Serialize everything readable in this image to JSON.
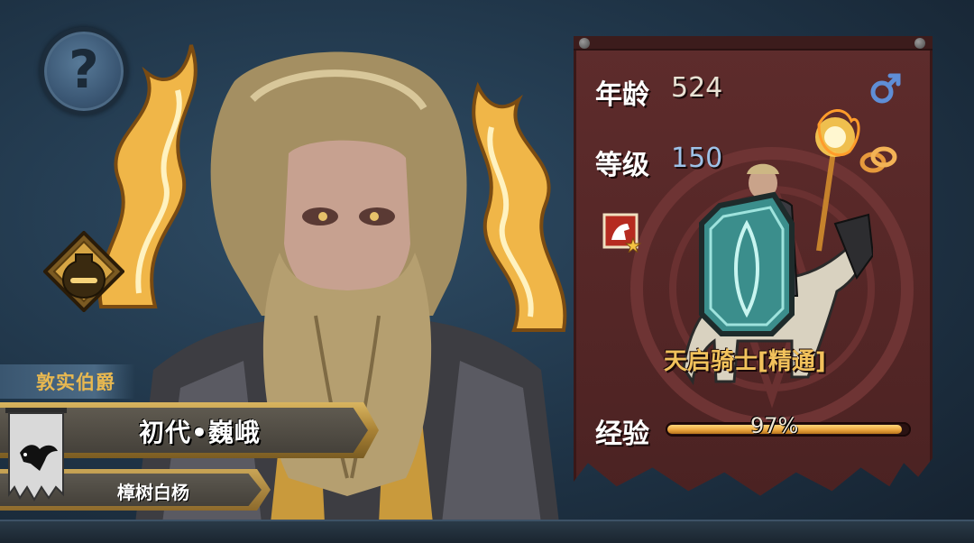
{
  "help": {
    "icon": "question-mark-icon",
    "symbol": "?"
  },
  "character": {
    "title": "敦实伯爵",
    "name": "初代•巍峨",
    "family": "樟树白杨",
    "banner_icon": "crow-banner-icon"
  },
  "stats": {
    "age_label": "年龄",
    "age_value": "524",
    "level_label": "等级",
    "level_value": "150",
    "gender_icon": "male-icon",
    "ring_icon": "ring-icon",
    "skill_icon": "horse-skill-badge-icon"
  },
  "unit": {
    "name": "天启骑士[精通]"
  },
  "experience": {
    "label": "经验",
    "percent_text": "97%",
    "fraction": 0.97
  },
  "colors": {
    "flame_gold": "#f0b648",
    "panel_red": "#5e2c2c",
    "title_gold": "#e8b850",
    "level_blue": "#9ec2e8",
    "unit_name_gold": "#f2c25c"
  }
}
